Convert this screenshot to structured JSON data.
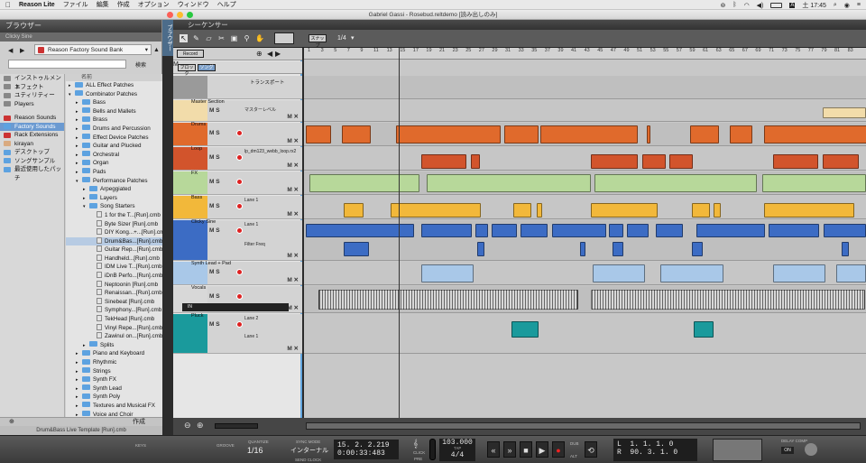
{
  "menubar": {
    "apple": "",
    "app": "Reason Lite",
    "items": [
      "ファイル",
      "編集",
      "作成",
      "オプション",
      "ウィンドウ",
      "ヘルプ"
    ],
    "clock": "土 17:45"
  },
  "window_title": "Gabriel Gassi - Rosebud.reltdemo [読み出しのみ]",
  "browser": {
    "title": "ブラウザー",
    "subtitle": "Clicky Sine",
    "bank": "Reason Factory Sound Bank",
    "search_button": "検索",
    "left_items": [
      "インストゥルメント",
      "エフェクト",
      "ユティリティー",
      "Players",
      "Reason Sounds",
      "Factory Sounds",
      "Rack Extensions",
      "kirayan",
      "デスクトップ",
      "ソングサンプル",
      "最近使用したパッチ"
    ],
    "column_header": "名前",
    "tree": [
      {
        "label": "ALL Effect Patches",
        "depth": 0,
        "type": "folder",
        "arrow": "▸"
      },
      {
        "label": "Combinator Patches",
        "depth": 0,
        "type": "folder",
        "arrow": "▾"
      },
      {
        "label": "Bass",
        "depth": 1,
        "type": "folder",
        "arrow": "▸"
      },
      {
        "label": "Bells and Mallets",
        "depth": 1,
        "type": "folder",
        "arrow": "▸"
      },
      {
        "label": "Brass",
        "depth": 1,
        "type": "folder",
        "arrow": "▸"
      },
      {
        "label": "Drums and Percussion",
        "depth": 1,
        "type": "folder",
        "arrow": "▸"
      },
      {
        "label": "Effect Device Patches",
        "depth": 1,
        "type": "folder",
        "arrow": "▸"
      },
      {
        "label": "Guitar and Plucked",
        "depth": 1,
        "type": "folder",
        "arrow": "▸"
      },
      {
        "label": "Orchestral",
        "depth": 1,
        "type": "folder",
        "arrow": "▸"
      },
      {
        "label": "Organ",
        "depth": 1,
        "type": "folder",
        "arrow": "▸"
      },
      {
        "label": "Pads",
        "depth": 1,
        "type": "folder",
        "arrow": "▸"
      },
      {
        "label": "Performance Patches",
        "depth": 1,
        "type": "folder",
        "arrow": "▾"
      },
      {
        "label": "Arpeggiated",
        "depth": 2,
        "type": "folder",
        "arrow": "▸"
      },
      {
        "label": "Layers",
        "depth": 2,
        "type": "folder",
        "arrow": "▸"
      },
      {
        "label": "Song Starters",
        "depth": 2,
        "type": "folder",
        "arrow": "▾"
      },
      {
        "label": "1 for the T...[Run].cmb",
        "depth": 3,
        "type": "file"
      },
      {
        "label": "Byte Sizer [Run].cmb",
        "depth": 3,
        "type": "file"
      },
      {
        "label": "DIY Kong...+...[Run].cmb",
        "depth": 3,
        "type": "file"
      },
      {
        "label": "Drum&Bas...[Run].cmb",
        "depth": 3,
        "type": "file",
        "selected": true
      },
      {
        "label": "Guitar Rep...[Run].cmb",
        "depth": 3,
        "type": "file"
      },
      {
        "label": "Handheld...[Run].cmb",
        "depth": 3,
        "type": "file"
      },
      {
        "label": "IDM Live T...[Run].cmb",
        "depth": 3,
        "type": "file"
      },
      {
        "label": "iDnB Perfo...[Run].cmb",
        "depth": 3,
        "type": "file"
      },
      {
        "label": "Neptoonin [Run].cmb",
        "depth": 3,
        "type": "file"
      },
      {
        "label": "Renaissan...[Run].cmb",
        "depth": 3,
        "type": "file"
      },
      {
        "label": "Sinebeat [Run].cmb",
        "depth": 3,
        "type": "file"
      },
      {
        "label": "Symphony...[Run].cmb",
        "depth": 3,
        "type": "file"
      },
      {
        "label": "TekHead [Run].cmb",
        "depth": 3,
        "type": "file"
      },
      {
        "label": "Vinyl Repe...[Run].cmb",
        "depth": 3,
        "type": "file"
      },
      {
        "label": "Zawinul on...[Run].cmb",
        "depth": 3,
        "type": "file"
      },
      {
        "label": "Splits",
        "depth": 2,
        "type": "folder",
        "arrow": "▸"
      },
      {
        "label": "Piano and Keyboard",
        "depth": 1,
        "type": "folder",
        "arrow": "▸"
      },
      {
        "label": "Rhythmic",
        "depth": 1,
        "type": "folder",
        "arrow": "▸"
      },
      {
        "label": "Strings",
        "depth": 1,
        "type": "folder",
        "arrow": "▸"
      },
      {
        "label": "Synth FX",
        "depth": 1,
        "type": "folder",
        "arrow": "▸"
      },
      {
        "label": "Synth Lead",
        "depth": 1,
        "type": "folder",
        "arrow": "▸"
      },
      {
        "label": "Synth Poly",
        "depth": 1,
        "type": "folder",
        "arrow": "▸"
      },
      {
        "label": "Textures and Musical FX",
        "depth": 1,
        "type": "folder",
        "arrow": "▸"
      },
      {
        "label": "Voice and Choir",
        "depth": 1,
        "type": "folder",
        "arrow": "▸"
      }
    ],
    "create_label": "作成",
    "footer": "Drum&Bass Live Template [Run].cmb"
  },
  "sequencer": {
    "title": "シーケンサー",
    "toolbar": {
      "snap_label": "スナップ",
      "snap_value": "1/4",
      "mode_label": "スクリプト\nモード"
    },
    "tracklist": {
      "rec_btn": "Record",
      "song_btn": "ソング",
      "block_btn": "ブロック",
      "tracks": [
        {
          "name": "トランスポート",
          "label": ""
        },
        {
          "name": "Master Section",
          "lane": "マスターレベル"
        },
        {
          "name": "Drums",
          "lane": ""
        },
        {
          "name": "Loop",
          "lane": "lp_dm123_webb_loop.rx2"
        },
        {
          "name": "FX",
          "lane": ""
        },
        {
          "name": "Bass",
          "lane": "Lane 1"
        },
        {
          "name": "Clicky Sine",
          "lane": "Lane 1",
          "lane2": "Filter Freq"
        },
        {
          "name": "Synth Lead + Pad",
          "lane": ""
        },
        {
          "name": "Vocals",
          "lane": "",
          "input": "IN"
        },
        {
          "name": "Pluck",
          "lane": "Lane 2",
          "lane2": "Lane 1"
        }
      ]
    },
    "ruler_ticks": [
      "1",
      "3",
      "5",
      "7",
      "9",
      "11",
      "13",
      "15",
      "17",
      "19",
      "21",
      "23",
      "25",
      "27",
      "29",
      "31",
      "33",
      "35",
      "37",
      "39",
      "41",
      "43",
      "45",
      "47",
      "49",
      "51",
      "53",
      "55",
      "57",
      "59",
      "61",
      "63",
      "65",
      "67",
      "69",
      "71",
      "73",
      "75",
      "77",
      "79",
      "81",
      "83"
    ]
  },
  "transport": {
    "keys_label": "KEYS",
    "groove_label": "GROOVE",
    "quantize_label": "QUANTIZE",
    "quantize_value": "1/16",
    "sync_label": "SYNC MODE",
    "sync_value": "インターナル",
    "send_clock": "SEND CLOCK",
    "position": "15. 2. 2.219",
    "time": "0:00:33:483",
    "click_label": "CLICK",
    "pre_label": "PRE",
    "tempo": "103.000",
    "tap_label": "TAP",
    "signature": "4/4",
    "dub_label": "DUB",
    "alt_label": "ALT",
    "loop_left": "1. 1. 1.  0",
    "loop_right": "90. 3. 1.  0",
    "loop_l": "L",
    "loop_r": "R",
    "on_label": "ON",
    "delay_label": "DELAY\nCOMP"
  },
  "colors": {
    "master": "#f2dcaa",
    "drums": "#e06a2c",
    "loop": "#d2542c",
    "fx": "#b7d89a",
    "bass": "#f2b83a",
    "clicky": "#3c6cc4",
    "synthlead": "#a9c8e8",
    "vocals": "#d8d8d8",
    "pluck": "#1a9a9c"
  }
}
